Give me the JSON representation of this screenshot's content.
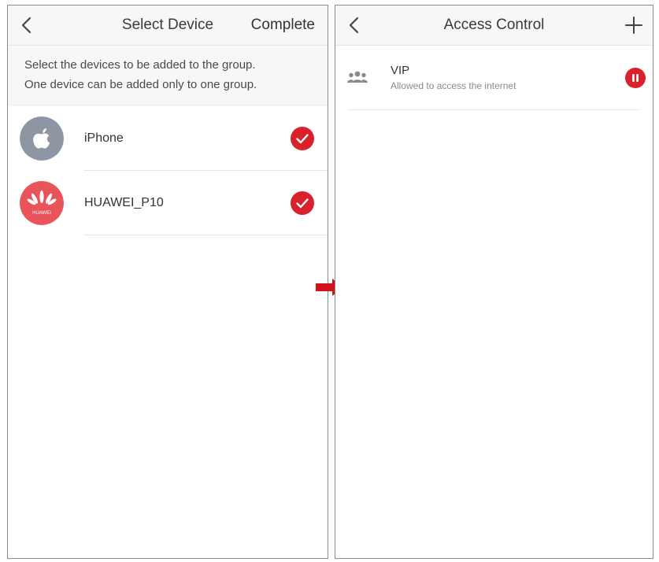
{
  "select_device": {
    "title": "Select Device",
    "complete_label": "Complete",
    "hint_line_1": "Select the devices to be added to the group.",
    "hint_line_2": "One device can be added only to one group.",
    "devices": [
      {
        "name": "iPhone",
        "icon": "apple-logo-icon",
        "avatar_color": "#8e96a3",
        "selected": true
      },
      {
        "name": "HUAWEI_P10",
        "icon": "huawei-logo-icon",
        "logo_text": "HUAWEI",
        "avatar_color": "#e9545a",
        "selected": true
      }
    ]
  },
  "access_control": {
    "title": "Access Control",
    "groups": [
      {
        "name": "VIP",
        "status": "Allowed to access the internet",
        "icon": "user-group-icon"
      }
    ]
  },
  "colors": {
    "accent_red": "#d9202b",
    "flow_arrow_red": "#d1121c",
    "navbar_bg": "#f7f7f7"
  }
}
